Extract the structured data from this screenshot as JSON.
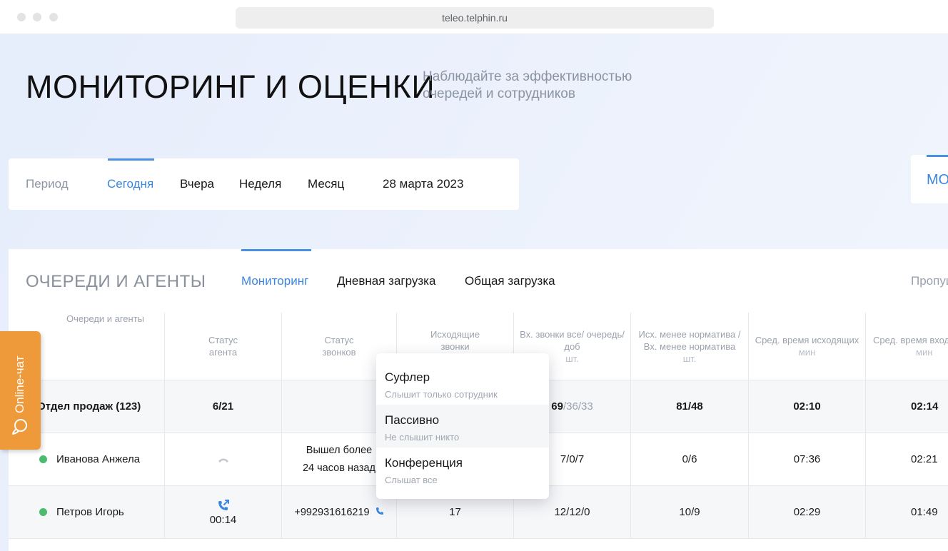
{
  "browser": {
    "url": "teleo.telphin.ru"
  },
  "header": {
    "title": "МОНИТОРИНГ И ОЦЕНКИ",
    "subtitle_line1": "Наблюдайте за эффективностью",
    "subtitle_line2": "очередей и сотрудников"
  },
  "period": {
    "label": "Период",
    "options": [
      "Сегодня",
      "Вчера",
      "Неделя",
      "Месяц"
    ],
    "selected": "Сегодня",
    "date": "28 марта 2023"
  },
  "right_card_text": "МО",
  "section": {
    "title": "ОЧЕРЕДИ И АГЕНТЫ",
    "tabs": [
      "Мониторинг",
      "Дневная загрузка",
      "Общая загрузка"
    ],
    "active_tab": "Мониторинг",
    "right_link": "Пропущ"
  },
  "table": {
    "headers": [
      {
        "text": "Очереди и агенты",
        "unit": ""
      },
      {
        "text": "Статус агента",
        "unit": ""
      },
      {
        "text": "Статус звонков",
        "unit": ""
      },
      {
        "text": "Исходящие звонки",
        "unit": ""
      },
      {
        "text": "Вх. звонки все/ очередь/ доб",
        "unit": "шт."
      },
      {
        "text": "Исх. менее норматива / Вх. менее норматива",
        "unit": "шт."
      },
      {
        "text": "Сред. время исходящих",
        "unit": "мин"
      },
      {
        "text": "Сред. время вход",
        "unit": "мин"
      }
    ],
    "group_row": {
      "name": "Отдел продаж (123)",
      "agent_status": "6/21",
      "call_status": "",
      "outgoing": "",
      "incoming_main": "69",
      "incoming_rest": "/36/33",
      "below_norm": "81/48",
      "avg_out": "02:10",
      "avg_in": "02:14"
    },
    "agents": [
      {
        "name": "Иванова Анжела",
        "status_color": "#4cbb6e",
        "agent_status_icon": "phone-idle-icon",
        "agent_status_time": "",
        "call_status_line1": "Вышел более",
        "call_status_line2": "24 часов назад",
        "outgoing": "",
        "incoming": "7/0/7",
        "below_norm": "0/6",
        "avg_out": "07:36",
        "avg_in": "02:21"
      },
      {
        "name": "Петров Игорь",
        "status_color": "#4cbb6e",
        "agent_status_icon": "phone-outgoing-icon",
        "agent_status_time": "00:14",
        "call_status_line1": "+992931616219",
        "call_status_line2": "",
        "outgoing": "17",
        "incoming": "12/12/0",
        "below_norm": "10/9",
        "avg_out": "02:29",
        "avg_in": "01:49"
      }
    ]
  },
  "listen_mode_menu": {
    "options": [
      {
        "title": "Суфлер",
        "description": "Слышит только сотрудник"
      },
      {
        "title": "Пассивно",
        "description": "Не слышит никто"
      },
      {
        "title": "Конференция",
        "description": "Слышат все"
      }
    ],
    "highlighted": "Пассивно"
  },
  "online_chat": {
    "label": "Online-чат",
    "icon": "chat-bubble-icon"
  },
  "colors": {
    "accent": "#3a86e0",
    "chat": "#ef9a3a",
    "online": "#4cbb6e"
  }
}
